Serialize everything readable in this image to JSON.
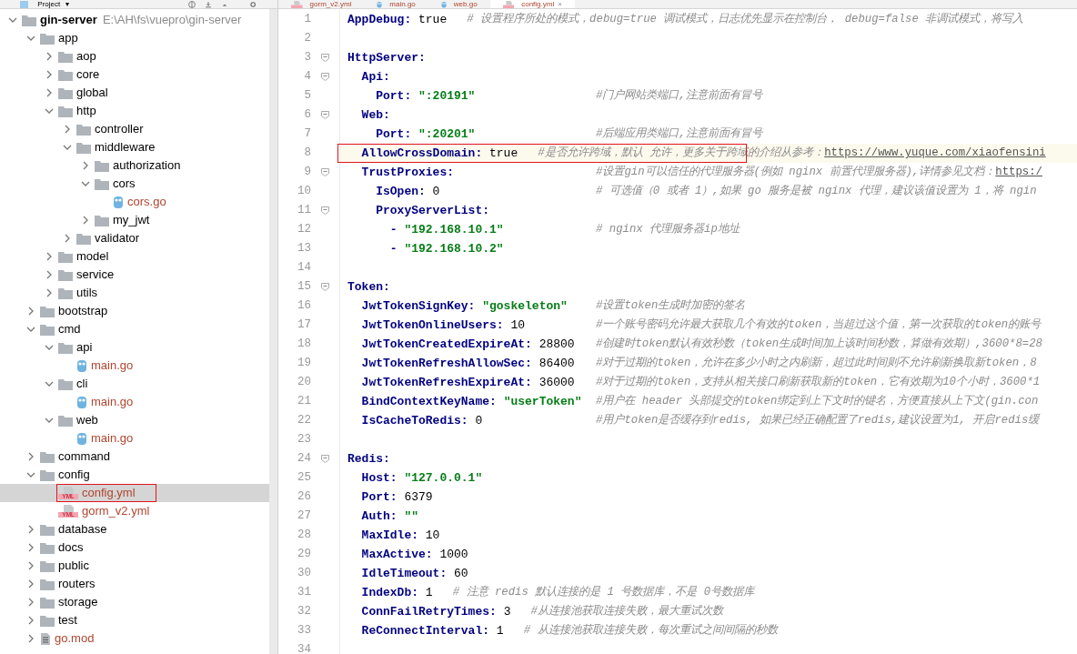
{
  "toolwindow": {
    "title": "Project",
    "dropdown": "▾"
  },
  "sidebar": {
    "tree": [
      {
        "label": "gin-server",
        "path": "E:\\AH\\fs\\vuepro\\gin-server",
        "kind": "folder",
        "expanded": true,
        "selected": false,
        "children": [
          {
            "label": "app",
            "kind": "folder",
            "expanded": true,
            "selected": false,
            "children": [
              {
                "label": "aop",
                "kind": "folder",
                "expanded": false,
                "selected": false
              },
              {
                "label": "core",
                "kind": "folder",
                "expanded": false,
                "selected": false
              },
              {
                "label": "global",
                "kind": "folder",
                "expanded": false,
                "selected": false
              },
              {
                "label": "http",
                "kind": "folder",
                "expanded": true,
                "selected": false,
                "children": [
                  {
                    "label": "controller",
                    "kind": "folder",
                    "expanded": false,
                    "selected": false
                  },
                  {
                    "label": "middleware",
                    "kind": "folder",
                    "expanded": true,
                    "selected": false,
                    "children": [
                      {
                        "label": "authorization",
                        "kind": "folder",
                        "expanded": false,
                        "selected": false
                      },
                      {
                        "label": "cors",
                        "kind": "folder",
                        "expanded": true,
                        "selected": false,
                        "children": [
                          {
                            "label": "cors.go",
                            "kind": "go",
                            "selected": false
                          }
                        ]
                      },
                      {
                        "label": "my_jwt",
                        "kind": "folder",
                        "expanded": false,
                        "selected": false
                      }
                    ]
                  },
                  {
                    "label": "validator",
                    "kind": "folder",
                    "expanded": false,
                    "selected": false
                  }
                ]
              },
              {
                "label": "model",
                "kind": "folder",
                "expanded": false,
                "selected": false
              },
              {
                "label": "service",
                "kind": "folder",
                "expanded": false,
                "selected": false
              },
              {
                "label": "utils",
                "kind": "folder",
                "expanded": false,
                "selected": false
              }
            ]
          },
          {
            "label": "bootstrap",
            "kind": "folder",
            "expanded": false,
            "selected": false
          },
          {
            "label": "cmd",
            "kind": "folder",
            "expanded": true,
            "selected": false,
            "children": [
              {
                "label": "api",
                "kind": "folder",
                "expanded": true,
                "selected": false,
                "children": [
                  {
                    "label": "main.go",
                    "kind": "go",
                    "selected": false
                  }
                ]
              },
              {
                "label": "cli",
                "kind": "folder",
                "expanded": true,
                "selected": false,
                "children": [
                  {
                    "label": "main.go",
                    "kind": "go",
                    "selected": false
                  }
                ]
              },
              {
                "label": "web",
                "kind": "folder",
                "expanded": true,
                "selected": false,
                "children": [
                  {
                    "label": "main.go",
                    "kind": "go",
                    "selected": false
                  }
                ]
              }
            ]
          },
          {
            "label": "command",
            "kind": "folder",
            "expanded": false,
            "selected": false
          },
          {
            "label": "config",
            "kind": "folder",
            "expanded": true,
            "selected": false,
            "children": [
              {
                "label": "config.yml",
                "kind": "yml",
                "badge": "YML",
                "selected": true,
                "boxed": true
              },
              {
                "label": "gorm_v2.yml",
                "kind": "yml",
                "badge": "YML",
                "selected": false
              }
            ]
          },
          {
            "label": "database",
            "kind": "folder",
            "expanded": false,
            "selected": false
          },
          {
            "label": "docs",
            "kind": "folder",
            "expanded": false,
            "selected": false
          },
          {
            "label": "public",
            "kind": "folder",
            "expanded": false,
            "selected": false
          },
          {
            "label": "routers",
            "kind": "folder",
            "expanded": false,
            "selected": false
          },
          {
            "label": "storage",
            "kind": "folder",
            "expanded": false,
            "selected": false
          },
          {
            "label": "test",
            "kind": "folder",
            "expanded": false,
            "selected": false
          },
          {
            "label": "go.mod",
            "kind": "mod",
            "expanded": false,
            "selected": false
          }
        ]
      }
    ]
  },
  "tabs": [
    {
      "label": "gorm_v2.yml",
      "kind": "yml",
      "selected": false
    },
    {
      "label": "main.go",
      "kind": "go",
      "selected": false
    },
    {
      "label": "web.go",
      "kind": "go",
      "selected": false
    },
    {
      "label": "config.yml",
      "kind": "yml",
      "selected": true,
      "close": "×"
    }
  ],
  "editor": {
    "lines": [
      {
        "number": "1",
        "key": "AppDebug:",
        "value": "true",
        "kind": "scalar",
        "comment": "# 设置程序所处的模式，debug=true 调试模式，日志优先显示在控制台， debug=false 非调试模式，将写入",
        "aligned": false
      },
      {
        "number": "2"
      },
      {
        "number": "3",
        "key": "HttpServer:",
        "children": [
          {
            "number": "4",
            "key": "Api:",
            "children": [
              {
                "number": "5",
                "key": "Port:",
                "value": "\":20191\"",
                "kind": "string",
                "comment": "#门户网站类端口,注意前面有冒号",
                "aligned": true
              }
            ]
          },
          {
            "number": "6",
            "key": "Web:",
            "children": [
              {
                "number": "7",
                "key": "Port:",
                "value": "\":20201\"",
                "kind": "string",
                "comment": "#后端应用类端口,注意前面有冒号",
                "aligned": true
              }
            ]
          },
          {
            "number": "8",
            "key": "AllowCrossDomain:",
            "value": "true",
            "kind": "scalar",
            "comment": "#是否允许跨域，默认 允许，更多关于跨域的介绍从参考：",
            "link": "https://www.yuque.com/xiaofensini",
            "aligned": false,
            "current": true,
            "boxed": true
          },
          {
            "number": "9",
            "key": "TrustProxies:",
            "comment": "#设置gin可以信任的代理服务器(例如 nginx 前置代理服务器),详情参见文档：",
            "link": "https:/",
            "aligned": true,
            "children": [
              {
                "number": "10",
                "key": "IsOpen:",
                "value": "0",
                "kind": "scalar",
                "comment": "# 可选值（0 或者 1）,如果 go 服务是被 nginx 代理，建议该值设置为 1，将 ngin",
                "aligned": true
              },
              {
                "number": "11",
                "key": "ProxyServerList:",
                "children": [
                  {
                    "number": "12",
                    "key": "-",
                    "value": "\"192.168.10.1\"",
                    "kind": "string",
                    "comment": "# nginx 代理服务器ip地址",
                    "aligned": true
                  },
                  {
                    "number": "13",
                    "key": "-",
                    "value": "\"192.168.10.2\"",
                    "kind": "string"
                  }
                ]
              }
            ]
          }
        ]
      },
      {
        "number": "14"
      },
      {
        "number": "15",
        "key": "Token:",
        "children": [
          {
            "number": "16",
            "key": "JwtTokenSignKey:",
            "value": "\"goskeleton\"",
            "kind": "string",
            "comment": "#设置token生成时加密的签名",
            "aligned": true
          },
          {
            "number": "17",
            "key": "JwtTokenOnlineUsers:",
            "value": "10",
            "kind": "scalar",
            "comment": "#一个账号密码允许最大获取几个有效的token，当超过这个值，第一次获取的token的账号",
            "aligned": true
          },
          {
            "number": "18",
            "key": "JwtTokenCreatedExpireAt:",
            "value": "28800",
            "kind": "scalar",
            "comment": "#创建时token默认有效秒数（token生成时间加上该时间秒数，算做有效期）,3600*8=28",
            "aligned": true
          },
          {
            "number": "19",
            "key": "JwtTokenRefreshAllowSec:",
            "value": "86400",
            "kind": "scalar",
            "comment": "#对于过期的token，允许在多少小时之内刷新，超过此时间则不允许刷新换取新token，8",
            "aligned": true
          },
          {
            "number": "20",
            "key": "JwtTokenRefreshExpireAt:",
            "value": "36000",
            "kind": "scalar",
            "comment": "#对于过期的token，支持从相关接口刷新获取新的token，它有效期为10个小时，3600*1",
            "aligned": true
          },
          {
            "number": "21",
            "key": "BindContextKeyName:",
            "value": "\"userToken\"",
            "kind": "string",
            "comment": "#用户在 header 头部提交的token绑定到上下文时的键名，方便直接从上下文(gin.con",
            "aligned": true
          },
          {
            "number": "22",
            "key": "IsCacheToRedis:",
            "value": "0",
            "kind": "scalar",
            "comment": "#用户token是否缓存到redis, 如果已经正确配置了redis,建议设置为1, 开启redis缓",
            "aligned": true
          }
        ]
      },
      {
        "number": "23"
      },
      {
        "number": "24",
        "key": "Redis:",
        "children": [
          {
            "number": "25",
            "key": "Host:",
            "value": "\"127.0.0.1\"",
            "kind": "string"
          },
          {
            "number": "26",
            "key": "Port:",
            "value": "6379",
            "kind": "scalar"
          },
          {
            "number": "27",
            "key": "Auth:",
            "value": "\"\"",
            "kind": "string"
          },
          {
            "number": "28",
            "key": "MaxIdle:",
            "value": "10",
            "kind": "scalar"
          },
          {
            "number": "29",
            "key": "MaxActive:",
            "value": "1000",
            "kind": "scalar"
          },
          {
            "number": "30",
            "key": "IdleTimeout:",
            "value": "60",
            "kind": "scalar"
          },
          {
            "number": "31",
            "key": "IndexDb:",
            "value": "1",
            "kind": "scalar",
            "comment": "# 注意 redis 默认连接的是 1 号数据库，不是 0号数据库",
            "aligned": false
          },
          {
            "number": "32",
            "key": "ConnFailRetryTimes:",
            "value": "3",
            "kind": "scalar",
            "comment": "#从连接池获取连接失败，最大重试次数",
            "aligned": false
          },
          {
            "number": "33",
            "key": "ReConnectInterval:",
            "value": "1",
            "kind": "scalar",
            "comment": "# 从连接池获取连接失败，每次重试之间间隔的秒数",
            "aligned": false
          }
        ]
      },
      {
        "number": "34"
      }
    ]
  }
}
